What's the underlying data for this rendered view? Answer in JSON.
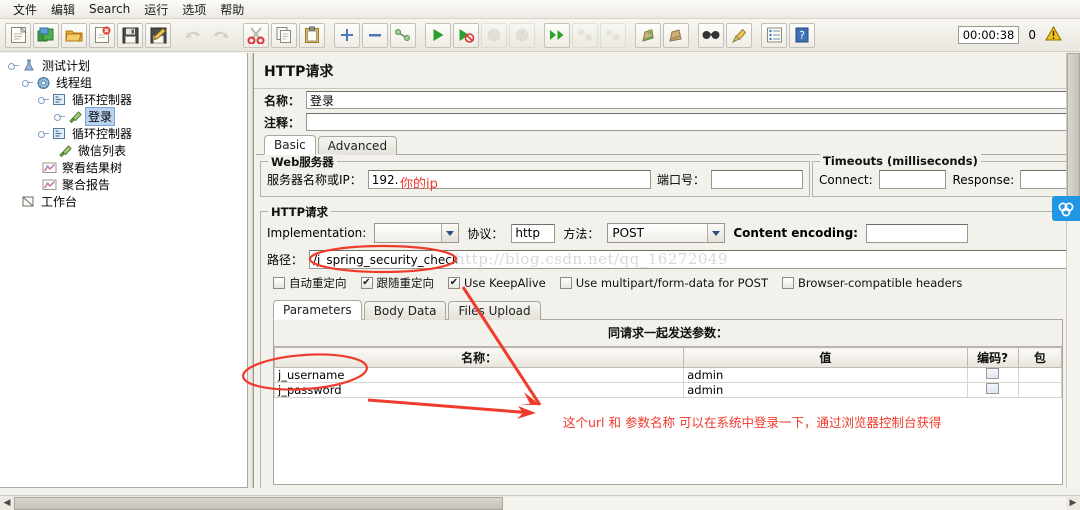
{
  "app": {
    "menu": [
      "文件",
      "编辑",
      "Search",
      "运行",
      "选项",
      "帮助"
    ],
    "toolbar_icons": [
      "new-icon",
      "templates-icon",
      "open-icon",
      "close-icon",
      "save-icon",
      "save-as-icon",
      "undo-icon",
      "redo-icon",
      "cut-icon",
      "copy-icon",
      "paste-icon",
      "expand-all-icon",
      "collapse-all-icon",
      "toggle-icon",
      "start-icon",
      "start-no-pauses-icon",
      "stop-icon",
      "shutdown-icon",
      "remote-start-all-icon",
      "remote-stop-all-icon",
      "remote-shutdown-all-icon",
      "clear-icon",
      "clear-all-icon",
      "search-icon",
      "reset-search-icon",
      "function-helper-icon",
      "help-icon"
    ],
    "timer": "00:00:38",
    "error_count": "0",
    "warning_icon": "warning-triangle-icon"
  },
  "tree": {
    "nodes": [
      {
        "label": "测试计划",
        "icon": "test-plan-icon",
        "depth": 0,
        "selected": false,
        "expander": true
      },
      {
        "label": "线程组",
        "icon": "thread-group-icon",
        "depth": 1,
        "selected": false,
        "expander": true
      },
      {
        "label": "循环控制器",
        "icon": "loop-controller-icon",
        "depth": 2,
        "selected": false,
        "expander": true
      },
      {
        "label": "登录",
        "icon": "http-sampler-icon",
        "depth": 3,
        "selected": true,
        "expander": true
      },
      {
        "label": "循环控制器",
        "icon": "loop-controller-icon",
        "depth": 2,
        "selected": false,
        "expander": true
      },
      {
        "label": "微信列表",
        "icon": "http-sampler-icon",
        "depth": 3,
        "selected": false,
        "expander": false
      },
      {
        "label": "察看结果树",
        "icon": "listener-icon",
        "depth": 2,
        "selected": false,
        "expander": false
      },
      {
        "label": "聚合报告",
        "icon": "listener-icon",
        "depth": 2,
        "selected": false,
        "expander": false
      },
      {
        "label": "工作台",
        "icon": "workbench-icon",
        "depth": 0,
        "selected": false,
        "expander": false
      }
    ]
  },
  "panel": {
    "title": "HTTP请求",
    "name_label": "名称：",
    "name_value": "登录",
    "comment_label": "注释：",
    "comment_value": "",
    "tabs": [
      {
        "label": "Basic",
        "active": true
      },
      {
        "label": "Advanced",
        "active": false
      }
    ],
    "web_server": {
      "legend": "Web服务器",
      "server_label": "服务器名称或IP：",
      "server_value": "192.",
      "port_label": "端口号：",
      "port_value": ""
    },
    "timeouts": {
      "legend": "Timeouts (milliseconds)",
      "connect_label": "Connect:",
      "connect_value": "",
      "response_label": "Response:",
      "response_value": ""
    },
    "http_request": {
      "legend": "HTTP请求",
      "implementation_label": "Implementation:",
      "implementation_value": "",
      "protocol_label": "协议：",
      "protocol_value": "http",
      "method_label": "方法：",
      "method_value": "POST",
      "content_encoding_label": "Content encoding:",
      "content_encoding_value": "",
      "path_label": "路径：",
      "path_value": "/j_spring_security_check"
    },
    "checkboxes": [
      {
        "label": "自动重定向",
        "checked": false
      },
      {
        "label": "跟随重定向",
        "checked": true
      },
      {
        "label": "Use KeepAlive",
        "checked": true
      },
      {
        "label": "Use multipart/form-data for POST",
        "checked": false
      },
      {
        "label": "Browser-compatible headers",
        "checked": false
      }
    ],
    "param_tabs": [
      {
        "label": "Parameters",
        "active": true
      },
      {
        "label": "Body Data",
        "active": false
      },
      {
        "label": "Files Upload",
        "active": false
      }
    ],
    "params_caption": "同请求一起发送参数：",
    "params_columns": [
      "名称：",
      "值",
      "编码?",
      "包"
    ],
    "params_rows": [
      {
        "name": "j_username",
        "value": "admin",
        "encode": false
      },
      {
        "name": "j_password",
        "value": "admin",
        "encode": false
      }
    ]
  },
  "annotations": {
    "server_ip_note": "你的ip",
    "bottom_note": "这个url 和 参数名称 可以在系统中登录一下，通过浏览器控制台获得",
    "watermark": "http://blog.csdn.net/qq_16272049"
  },
  "colors": {
    "annotation_red": "#f0392b",
    "selection_blue": "#b9d2ef",
    "widget_blue": "#2196e3",
    "panel_bg": "#f2f1ec"
  }
}
